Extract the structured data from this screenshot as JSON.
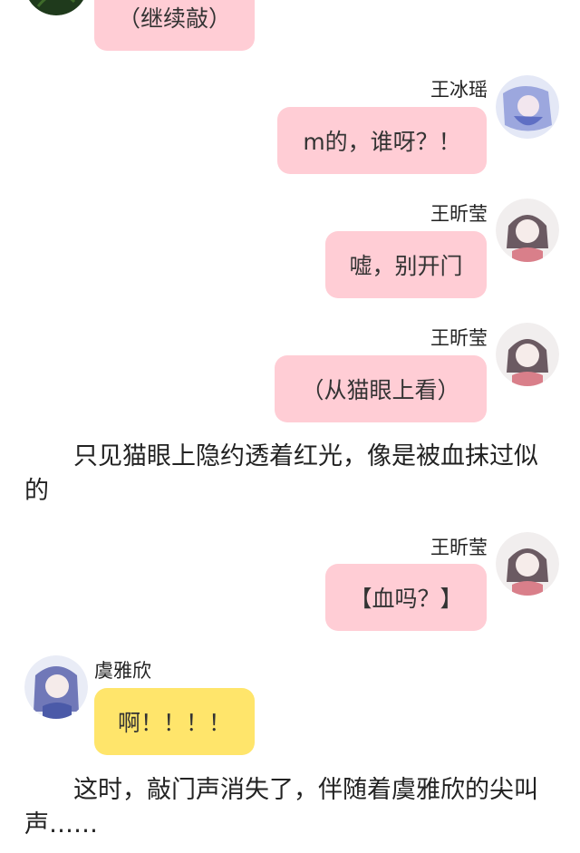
{
  "messages": [
    {
      "type": "bubble",
      "text": "（继续敲）",
      "color": "#ffcdd5"
    },
    {
      "type": "message",
      "sender": "王冰瑶",
      "text": "m的，谁呀？！",
      "color": "#ffcdd5"
    },
    {
      "type": "message",
      "sender": "王昕莹",
      "text": "嘘，别开门",
      "color": "#ffcdd5"
    },
    {
      "type": "message",
      "sender": "王昕莹",
      "text": "（从猫眼上看）",
      "color": "#ffcdd5"
    },
    {
      "type": "narration",
      "text": "只见猫眼上隐约透着红光，像是被血抹过似的"
    },
    {
      "type": "message",
      "sender": "王昕莹",
      "text": "【血吗？】",
      "color": "#ffcdd5"
    },
    {
      "type": "message",
      "sender": "虞雅欣",
      "text": "啊！！！！",
      "color": "#ffe56b"
    },
    {
      "type": "narration",
      "text": "这时，敲门声消失了，伴随着虞雅欣的尖叫声……"
    }
  ]
}
